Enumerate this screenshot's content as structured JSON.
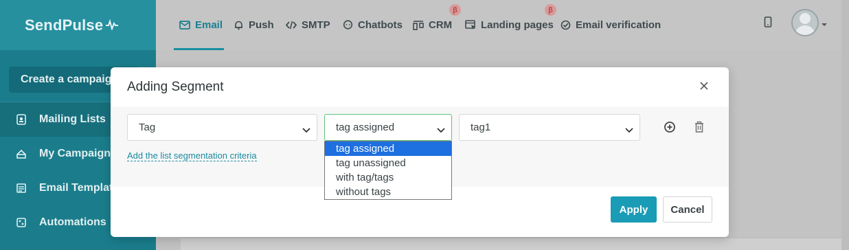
{
  "sidebar": {
    "brand": "SendPulse",
    "create_label": "Create a campaign",
    "items": [
      {
        "label": "Mailing Lists",
        "icon": "address-book-icon"
      },
      {
        "label": "My Campaigns",
        "icon": "send-icon"
      },
      {
        "label": "Email Templates",
        "icon": "templates-icon"
      },
      {
        "label": "Automations",
        "icon": "automation-icon"
      }
    ]
  },
  "topnav": {
    "items": [
      {
        "label": "Email",
        "icon": "envelope-icon",
        "active": true
      },
      {
        "label": "Push",
        "icon": "bell-icon"
      },
      {
        "label": "SMTP",
        "icon": "code-icon"
      },
      {
        "label": "Chatbots",
        "icon": "chat-icon"
      },
      {
        "label": "CRM",
        "icon": "crm-icon",
        "beta": "β"
      },
      {
        "label": "Landing pages",
        "icon": "landing-icon",
        "beta": "β"
      },
      {
        "label": "Email verification",
        "icon": "check-circle-icon"
      }
    ]
  },
  "modal": {
    "title": "Adding Segment",
    "field_select": "Tag",
    "condition_select": "tag assigned",
    "value_select": "tag1",
    "add_criteria_link": "Add the list segmentation criteria",
    "condition_options": [
      "tag assigned",
      "tag unassigned",
      "with tag/tags",
      "without tags"
    ],
    "apply_label": "Apply",
    "cancel_label": "Cancel"
  },
  "colors": {
    "accent": "#1a9bb6",
    "sidebar": "#1b7d8c",
    "focus_border": "#5cc27d",
    "option_highlight": "#1e6fe0"
  }
}
